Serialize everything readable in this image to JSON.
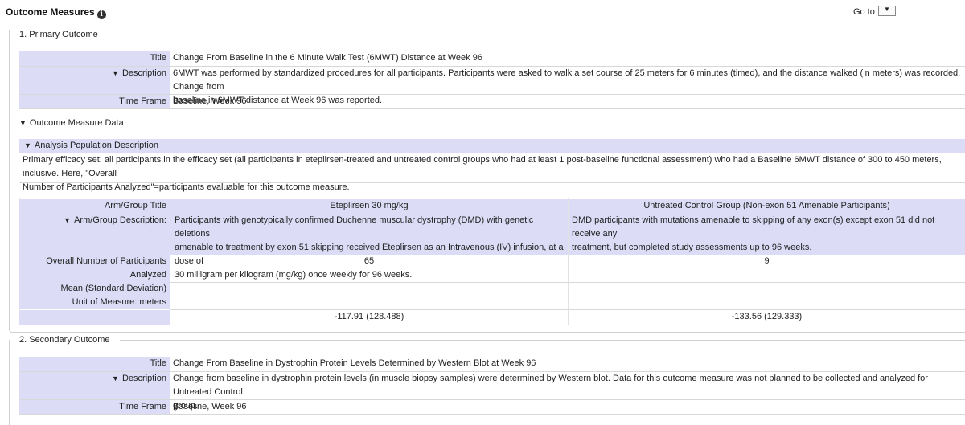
{
  "header": {
    "title": "Outcome Measures",
    "goto_label": "Go to",
    "goto_arrow": "▼",
    "info": "i"
  },
  "primary": {
    "legend": "1.   Primary Outcome",
    "title_label": "Title",
    "title": "Change From Baseline in the 6 Minute Walk Test (6MWT) Distance at Week 96",
    "description_label": "Description",
    "description_line1": "6MWT was performed by standardized procedures for all participants. Participants were asked to walk a set course of 25 meters for 6 minutes (timed), and the distance walked (in meters) was recorded. Change from",
    "description_line2": "baseline in 6MWT distance at Week 96 was reported.",
    "timeframe_label": "Time Frame",
    "timeframe": "Baseline, Week 96",
    "omd_label": "Outcome Measure Data",
    "apd_label": "Analysis Population Description",
    "apd_line1": "Primary efficacy set: all participants in the efficacy set (all participants in eteplirsen-treated and untreated control groups who had at least 1 post-baseline functional assessment) who had a Baseline 6MWT distance of 300 to 450 meters, inclusive. Here, \"Overall",
    "apd_line2": "Number of Participants Analyzed\"=participants evaluable for this outcome measure.",
    "table": {
      "arm_title_label": "Arm/Group Title",
      "arm_desc_label": "Arm/Group Description:",
      "arms": [
        {
          "title": "Eteplirsen 30 mg/kg",
          "desc_line1": "Participants with genotypically confirmed Duchenne muscular dystrophy (DMD) with genetic deletions",
          "desc_line2": "amenable to treatment by exon 51 skipping received Eteplirsen as an Intravenous (IV) infusion, at a dose of",
          "desc_line3": "30 milligram per kilogram (mg/kg) once weekly for 96 weeks.",
          "n": "65",
          "value": "-117.91  (128.488)"
        },
        {
          "title": "Untreated Control Group (Non-exon 51 Amenable Participants)",
          "desc_line1": "DMD participants with mutations amenable to skipping of any exon(s) except exon 51 did not receive any",
          "desc_line2": "treatment, but completed study assessments up to 96 weeks.",
          "desc_line3": "",
          "n": "9",
          "value": "-133.56  (129.333)"
        }
      ],
      "n_label_line1": "Overall Number of Participants",
      "n_label_line2": "Analyzed",
      "measure_line1": "Mean (Standard Deviation)",
      "measure_line2": "Unit of Measure: meters"
    }
  },
  "secondary": {
    "legend": "2.   Secondary Outcome",
    "title_label": "Title",
    "title": "Change From Baseline in Dystrophin Protein Levels Determined by Western Blot at Week 96",
    "description_label": "Description",
    "description_line1": "Change from baseline in dystrophin protein levels (in muscle biopsy samples) were determined by Western blot. Data for this outcome measure was not planned to be collected and analyzed for Untreated Control",
    "description_line2": "group.",
    "timeframe_label": "Time Frame",
    "timeframe": "Baseline, Week 96"
  }
}
